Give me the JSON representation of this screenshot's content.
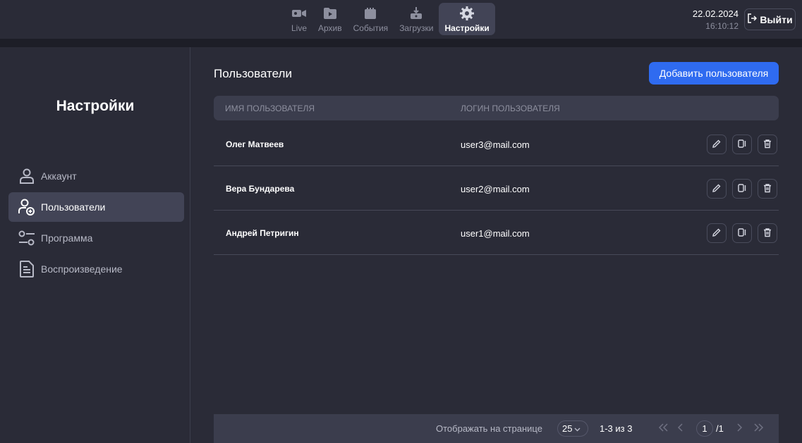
{
  "nav": {
    "tabs": [
      {
        "label": "Live",
        "icon": "camera-icon"
      },
      {
        "label": "Архив",
        "icon": "folder-play-icon"
      },
      {
        "label": "События",
        "icon": "clapper-icon"
      },
      {
        "label": "Загрузки",
        "icon": "download-icon"
      },
      {
        "label": "Настройки",
        "icon": "gear-icon"
      }
    ],
    "active": "Настройки"
  },
  "header": {
    "date": "22.02.2024",
    "time": "16:10:12",
    "logout_label": "Выйти"
  },
  "sidebar": {
    "title": "Настройки",
    "items": [
      {
        "label": "Аккаунт",
        "icon": "user-icon"
      },
      {
        "label": "Пользователи",
        "icon": "user-add-icon"
      },
      {
        "label": "Программа",
        "icon": "sliders-icon"
      },
      {
        "label": "Воспроизведение",
        "icon": "document-icon"
      }
    ],
    "active": "Пользователи"
  },
  "main": {
    "title": "Пользователи",
    "add_button": "Добавить пользователя",
    "columns": [
      "Имя пользователя",
      "Логин пользователя"
    ],
    "rows": [
      {
        "name": "Олег Матвеев",
        "login": "user3@mail.com"
      },
      {
        "name": "Вера Бундарева",
        "login": "user2@mail.com"
      },
      {
        "name": "Андрей Петригин",
        "login": "user1@mail.com"
      }
    ]
  },
  "pagination": {
    "per_page_label": "Отображать на странице",
    "per_page": "25",
    "range": "1-3 из 3",
    "page": "1",
    "total": "/1"
  },
  "colors": {
    "background": "#2a2b37",
    "accent": "#2f6bf0",
    "active_item": "#424456"
  }
}
